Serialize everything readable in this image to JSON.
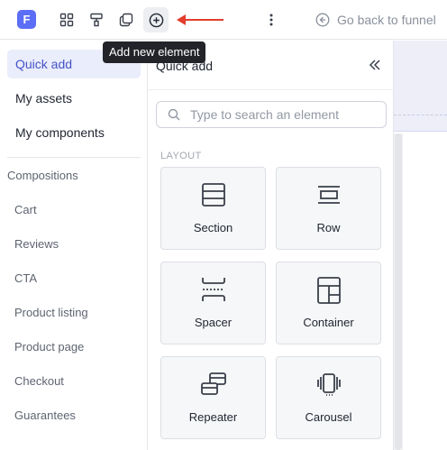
{
  "app": {
    "logo_letter": "F"
  },
  "toolbar": {
    "buttons": [
      {
        "id": "layers",
        "icon": "grid-icon"
      },
      {
        "id": "styles",
        "icon": "paint-roller-icon"
      },
      {
        "id": "pages",
        "icon": "copy-icon"
      },
      {
        "id": "add",
        "icon": "plus-circle-icon",
        "active": true
      }
    ],
    "more_icon": "vertical-dots-icon",
    "back_label": "Go back to funnel"
  },
  "tooltip": {
    "text": "Add new element"
  },
  "sidebar": {
    "items": [
      {
        "label": "Quick add",
        "selected": true
      },
      {
        "label": "My assets"
      },
      {
        "label": "My components"
      }
    ],
    "compositions_heading": "Compositions",
    "compositions": [
      "Cart",
      "Reviews",
      "CTA",
      "Product listing",
      "Product page",
      "Checkout",
      "Guarantees"
    ]
  },
  "panel": {
    "title": "Quick add",
    "search_placeholder": "Type to search an element",
    "section_label": "LAYOUT",
    "elements": [
      {
        "label": "Section",
        "icon": "section-icon"
      },
      {
        "label": "Row",
        "icon": "row-icon"
      },
      {
        "label": "Spacer",
        "icon": "spacer-icon"
      },
      {
        "label": "Container",
        "icon": "container-icon"
      },
      {
        "label": "Repeater",
        "icon": "repeater-icon"
      },
      {
        "label": "Carousel",
        "icon": "carousel-icon"
      }
    ]
  },
  "colors": {
    "accent": "#5b6ef5",
    "selected_bg": "#eaedfb",
    "selected_text": "#4453c6",
    "arrow": "#e23d2d",
    "tooltip_bg": "#222429"
  }
}
